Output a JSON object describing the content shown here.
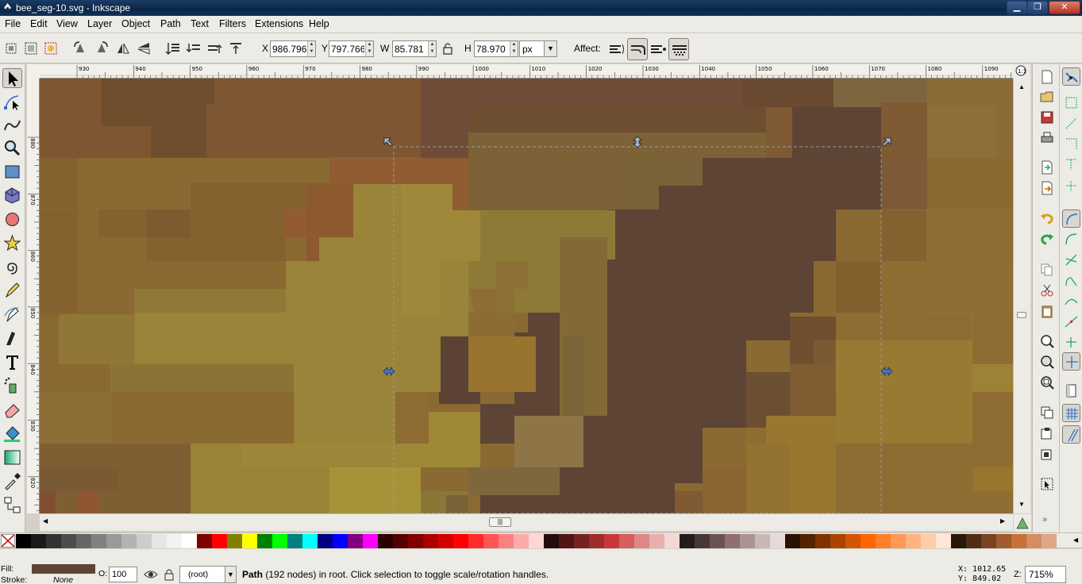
{
  "window": {
    "title": "bee_seg-10.svg - Inkscape",
    "minimize": "▁",
    "maximize": "❐",
    "close": "✕"
  },
  "menu": [
    "File",
    "Edit",
    "View",
    "Layer",
    "Object",
    "Path",
    "Text",
    "Filters",
    "Extensions",
    "Help"
  ],
  "toolbar": {
    "x_label": "X",
    "x_value": "986.796",
    "y_label": "Y",
    "y_value": "797.766",
    "w_label": "W",
    "w_value": "85.781",
    "h_label": "H",
    "h_value": "78.970",
    "unit": "px",
    "affect_label": "Affect:"
  },
  "ruler_top_labels": [
    "930",
    "940",
    "950",
    "960",
    "970",
    "980",
    "990",
    "1000",
    "1010",
    "1020",
    "1030",
    "1040",
    "1050",
    "1060",
    "1070",
    "1080",
    "1090"
  ],
  "ruler_left_labels": [
    "880",
    "870",
    "860",
    "850",
    "840",
    "830",
    "820"
  ],
  "status": {
    "fill_label": "Fill:",
    "stroke_label": "Stroke:",
    "stroke_value": "None",
    "fill_color": "#5e4533",
    "opacity_label": "O:",
    "opacity_value": "100",
    "layer": "(root)",
    "message_bold": "Path",
    "message_rest": " (192 nodes) in root. Click selection to toggle scale/rotation handles.",
    "x_coord": "X: 1012.65",
    "y_coord": "Y:   849.02",
    "zoom_label": "Z:",
    "zoom_value": "715%"
  },
  "palette": [
    "#000000",
    "#1a1a1a",
    "#333333",
    "#4d4d4d",
    "#666666",
    "#808080",
    "#999999",
    "#b3b3b3",
    "#cccccc",
    "#e6e6e6",
    "#f2f2f2",
    "#ffffff",
    "#800000",
    "#ff0000",
    "#808000",
    "#ffff00",
    "#008000",
    "#00ff00",
    "#008080",
    "#00ffff",
    "#000080",
    "#0000ff",
    "#800080",
    "#ff00ff",
    "#2b0000",
    "#550000",
    "#800000",
    "#aa0000",
    "#d40000",
    "#ff0000",
    "#ff2a2a",
    "#ff5555",
    "#ff8080",
    "#ffaaaa",
    "#ffd5d5",
    "#280b0b",
    "#501616",
    "#782121",
    "#a02c2c",
    "#c83737",
    "#d35f5f",
    "#de8787",
    "#e9afaf",
    "#f4d7d7",
    "#241c1c",
    "#483737",
    "#6c5353",
    "#916f6f",
    "#ac9393",
    "#c8b7b7",
    "#e3dbdb",
    "#2b1100",
    "#552200",
    "#803300",
    "#aa4400",
    "#d45500",
    "#ff6600",
    "#ff7f2a",
    "#ff9955",
    "#ffb380",
    "#ffccaa",
    "#ffe6d5",
    "#28170b",
    "#502d16",
    "#784421",
    "#a05a2c",
    "#c87137",
    "#d38d5f",
    "#dea787"
  ]
}
